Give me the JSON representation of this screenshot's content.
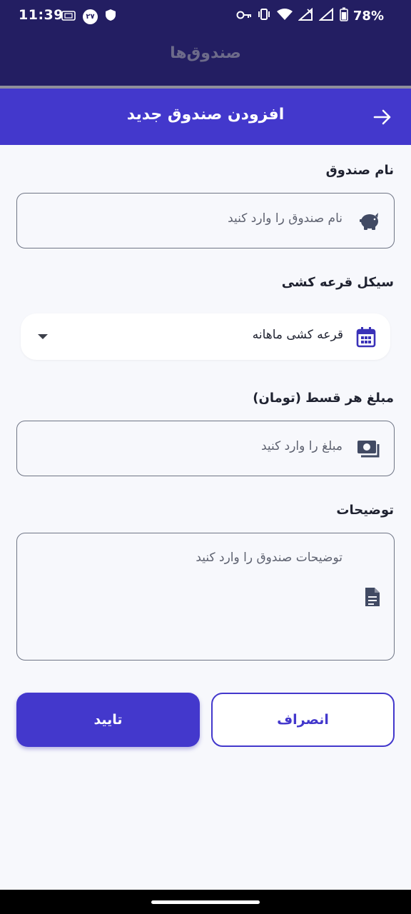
{
  "status_bar": {
    "time": "11:39",
    "badge": "۲۷",
    "battery": "78%"
  },
  "background_screen": {
    "title": "صندوق‌ها"
  },
  "sheet": {
    "title": "افزودن صندوق جدید",
    "back_icon": "arrow-right-icon"
  },
  "form": {
    "name": {
      "label": "نام صندوق",
      "placeholder": "نام صندوق را وارد کنید",
      "value": "",
      "icon": "piggy-bank-icon"
    },
    "cycle": {
      "label": "سیکل قرعه کشی",
      "selected": "قرعه کشی ماهانه",
      "icon": "calendar-icon"
    },
    "amount": {
      "label": "مبلغ هر قسط (تومان)",
      "placeholder": "مبلغ را وارد کنید",
      "value": "",
      "icon": "money-icon"
    },
    "description": {
      "label": "توضیحات",
      "placeholder": "توضیحات صندوق را وارد کنید",
      "value": "",
      "icon": "document-icon"
    }
  },
  "actions": {
    "confirm": "تایید",
    "cancel": "انصراف"
  },
  "colors": {
    "primary": "#4338cc",
    "status_bar": "#231e62",
    "background": "#f7f8fc"
  }
}
